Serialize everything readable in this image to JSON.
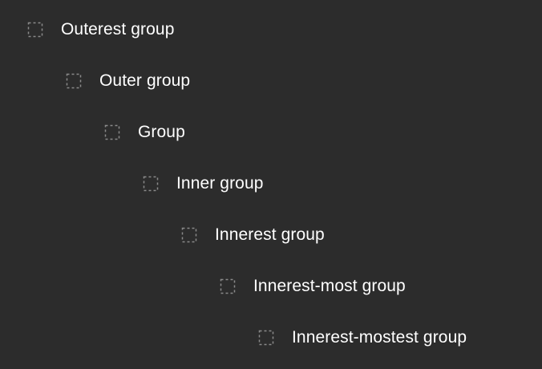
{
  "layers_panel": {
    "items": [
      {
        "label": "Outerest group",
        "icon": "frame-group-dashed-icon"
      },
      {
        "label": "Outer group",
        "icon": "frame-group-dashed-icon"
      },
      {
        "label": "Group",
        "icon": "frame-group-dashed-icon"
      },
      {
        "label": "Inner group",
        "icon": "frame-group-dashed-icon"
      },
      {
        "label": "Innerest group",
        "icon": "frame-group-dashed-icon"
      },
      {
        "label": "Innerest-most group",
        "icon": "frame-group-dashed-icon"
      },
      {
        "label": "Innerest-mostest group",
        "icon": "frame-group-dashed-icon"
      }
    ],
    "colors": {
      "background": "#2c2c2c",
      "text": "#ffffff",
      "icon": "#8a8a8a"
    }
  }
}
